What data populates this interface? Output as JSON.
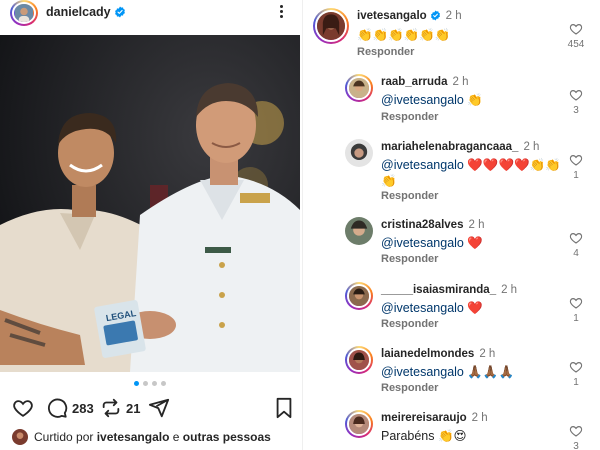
{
  "post": {
    "username": "danielcady",
    "verified": true,
    "photo_text": "LEGAL",
    "carousel_dots": 4,
    "carousel_active": 1,
    "actions": {
      "comments_count": "283",
      "reposts_count": "21"
    },
    "liked_by": {
      "prefix": "Curtido por",
      "user": "ivetesangalo",
      "suffix": "e",
      "others": "outras pessoas"
    }
  },
  "comments": [
    {
      "username": "ivetesangalo",
      "verified": true,
      "time": "2 h",
      "mention": "",
      "text": "👏👏👏👏👏👏",
      "text2": "",
      "reply_label": "Responder",
      "likes": "454",
      "avatar_color": "#7a3b2e"
    },
    {
      "username": "raab_arruda",
      "verified": false,
      "time": "2 h",
      "mention": "@ivetesangalo",
      "text": " 👏",
      "text2": "",
      "reply_label": "Responder",
      "likes": "3",
      "avatar_color": "#c9b28a"
    },
    {
      "username": "mariahelenabragancaaa_",
      "verified": false,
      "time": "2 h",
      "mention": "@ivetesangalo",
      "text": " ❤️❤️❤️❤️👏👏",
      "text2": "👏",
      "reply_label": "Responder",
      "likes": "1",
      "avatar_color": "#3b3b3b"
    },
    {
      "username": "cristina28alves",
      "verified": false,
      "time": "2 h",
      "mention": "@ivetesangalo",
      "text": " ❤️",
      "text2": "",
      "reply_label": "Responder",
      "likes": "4",
      "avatar_color": "#6d7d6a"
    },
    {
      "username": "_____isaiasmiranda_",
      "verified": false,
      "time": "2 h",
      "mention": "@ivetesangalo",
      "text": " ❤️",
      "text2": "",
      "reply_label": "Responder",
      "likes": "1",
      "avatar_color": "#8a6a4e"
    },
    {
      "username": "laianedelmondes",
      "verified": false,
      "time": "2 h",
      "mention": "@ivetesangalo",
      "text": " 🙏🏾🙏🏾🙏🏾",
      "text2": "",
      "reply_label": "Responder",
      "likes": "1",
      "avatar_color": "#a0524a"
    },
    {
      "username": "meirereisaraujo",
      "verified": false,
      "time": "2 h",
      "mention": "",
      "text": "Parabéns 👏😍",
      "text2": "",
      "reply_label": "",
      "likes": "3",
      "avatar_color": "#b58a7a"
    }
  ],
  "colors": {
    "accent": "#0095f6",
    "mention": "#00376b",
    "muted": "#737373",
    "text": "#262626"
  }
}
